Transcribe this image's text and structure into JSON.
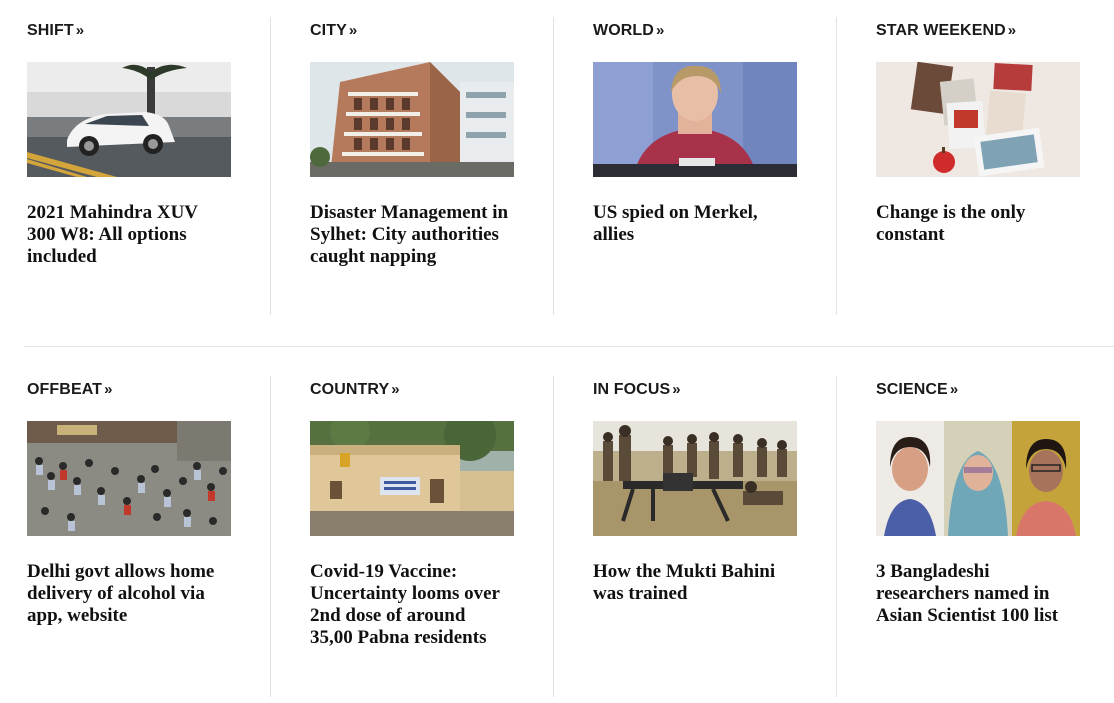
{
  "sections": [
    {
      "category": "SHIFT",
      "headline": "2021 Mahindra XUV 300 W8: All options included",
      "image_icon": "car-photo-icon"
    },
    {
      "category": "CITY",
      "headline": "Disaster Management in Sylhet: City authorities caught napping",
      "image_icon": "building-photo-icon"
    },
    {
      "category": "WORLD",
      "headline": "US spied on Merkel, allies",
      "image_icon": "portrait-photo-icon"
    },
    {
      "category": "STAR WEEKEND",
      "headline": "Change is the only constant",
      "image_icon": "magazines-photo-icon"
    },
    {
      "category": "OFFBEAT",
      "headline": "Delhi govt allows home delivery of alcohol via app, website",
      "image_icon": "crowd-photo-icon"
    },
    {
      "category": "COUNTRY",
      "headline": "Covid-19 Vaccine: Uncertainty looms over 2nd dose of around 35,00 Pabna residents",
      "image_icon": "health-center-photo-icon"
    },
    {
      "category": "IN FOCUS",
      "headline": "How the Mukti Bahini was trained",
      "image_icon": "training-photo-icon"
    },
    {
      "category": "SCIENCE",
      "headline": "3 Bangladeshi researchers named in Asian Scientist 100 list",
      "image_icon": "researchers-photo-icon"
    }
  ],
  "chevron_glyph": "»"
}
